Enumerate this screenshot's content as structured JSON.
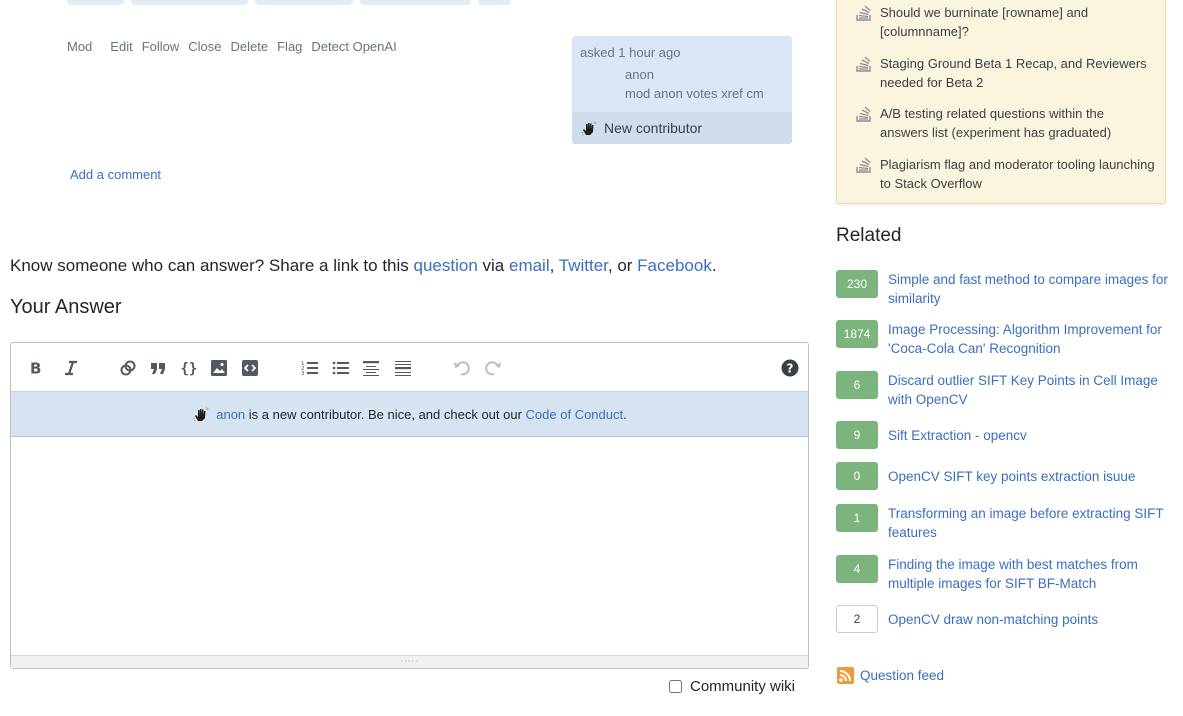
{
  "tags": [
    "",
    "",
    "",
    "",
    ""
  ],
  "post_menu": {
    "mod": "Mod",
    "items": [
      "Edit",
      "Follow",
      "Close",
      "Delete",
      "Flag",
      "Detect OpenAI"
    ]
  },
  "user_card": {
    "asked": "asked 1 hour ago",
    "username": "anon",
    "flair": "mod anon votes xref cm",
    "new_contributor": "New contributor"
  },
  "add_comment": "Add a comment",
  "share": {
    "prefix": "Know someone who can answer? Share a link to this ",
    "question_link": "question",
    "via": " via ",
    "email_link": "email",
    "comma": ", ",
    "twitter_link": "Twitter",
    "or": ", or ",
    "facebook_link": "Facebook",
    "end": "."
  },
  "your_answer": "Your Answer",
  "editor": {
    "toolbar": [
      "bold",
      "italic",
      "link",
      "blockquote",
      "code",
      "image",
      "snippet",
      "ordered-list",
      "unordered-list",
      "heading",
      "horizontal-rule",
      "undo",
      "redo",
      "help"
    ],
    "notice": {
      "user_link": "anon",
      "text": " is a new contributor. Be nice, and check out our ",
      "coc_link": "Code of Conduct",
      "end": "."
    },
    "body": "",
    "grip": "·····"
  },
  "community_wiki": {
    "label": "Community wiki",
    "checked": false
  },
  "featured_meta": [
    "Should we burninate [rowname] and [columnname]?",
    "Staging Ground Beta 1 Recap, and Reviewers needed for Beta 2",
    "A/B testing related questions within the answers list (experiment has graduated)",
    "Plagiarism flag and moderator tooling launching to Stack Overflow"
  ],
  "related": {
    "title": "Related",
    "items": [
      {
        "score": "230",
        "answered": true,
        "title": "Simple and fast method to compare images for similarity"
      },
      {
        "score": "1874",
        "answered": true,
        "title": "Image Processing: Algorithm Improvement for 'Coca-Cola Can' Recognition"
      },
      {
        "score": "6",
        "answered": true,
        "title": "Discard outlier SIFT Key Points in Cell Image with OpenCV"
      },
      {
        "score": "9",
        "answered": true,
        "title": "Sift Extraction - opencv"
      },
      {
        "score": "0",
        "answered": true,
        "title": "OpenCV SIFT key points extraction isuue"
      },
      {
        "score": "1",
        "answered": true,
        "title": "Transforming an image before extracting SIFT features"
      },
      {
        "score": "4",
        "answered": true,
        "title": "Finding the image with best matches from multiple images for SIFT BF-Match"
      },
      {
        "score": "2",
        "answered": false,
        "title": "OpenCV draw non-matching points"
      }
    ]
  },
  "question_feed": "Question feed",
  "colors": {
    "link": "#3b6ec0",
    "answered_score": "#7bb57d",
    "featured_bg": "#fbf5e0",
    "user_card_bg": "#d9e6f5",
    "notice_bg": "#d6e3f0",
    "rss": "#f0993b"
  }
}
